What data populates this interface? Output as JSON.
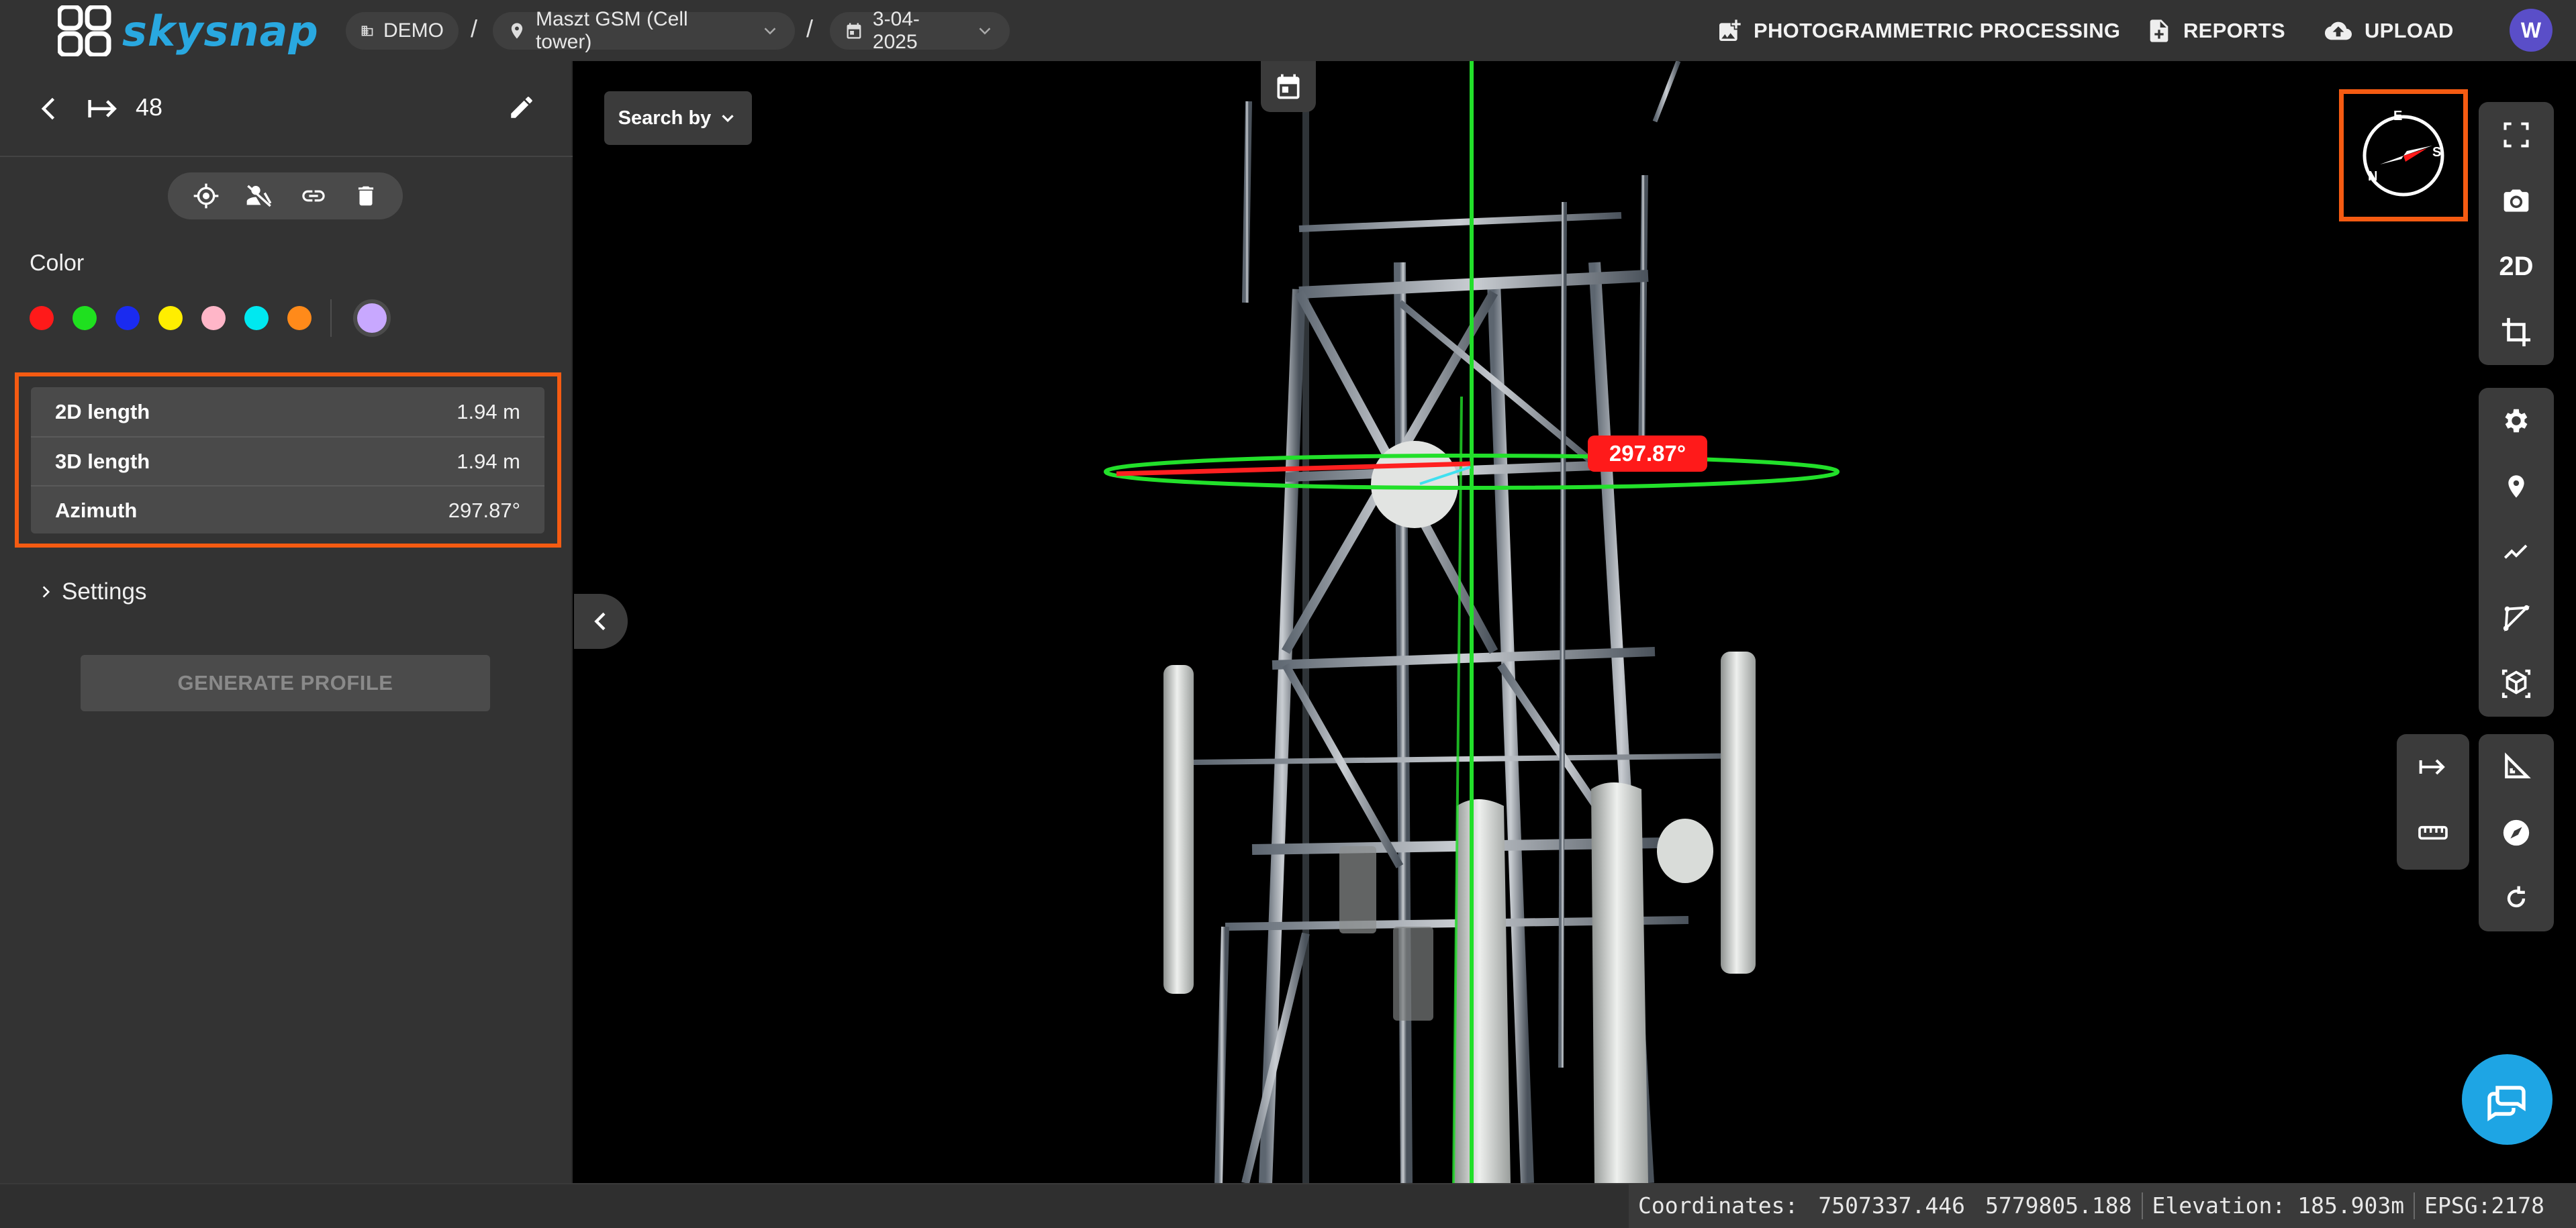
{
  "brand": {
    "name": "skysnap",
    "color": "#29a8e0"
  },
  "breadcrumb": {
    "org": "DEMO",
    "site": "Maszt GSM (Cell tower)",
    "date": "3-04-2025",
    "separator": "/"
  },
  "top_actions": {
    "processing": "PHOTOGRAMMETRIC PROCESSING",
    "reports": "REPORTS",
    "upload": "UPLOAD",
    "avatar_initial": "W"
  },
  "sidebar": {
    "measurement_id": "48",
    "tools": [
      "locate-icon",
      "hide-icon",
      "link-icon",
      "delete-icon"
    ],
    "color_label": "Color",
    "colors": [
      "#ff1a1a",
      "#1fe01f",
      "#1a2bf0",
      "#ffee00",
      "#ffb6c8",
      "#00e8f0",
      "#ff8a1a"
    ],
    "selected_color": "#c8a8ff",
    "properties": [
      {
        "label": "2D length",
        "value": "1.94 m"
      },
      {
        "label": "3D length",
        "value": "1.94 m"
      },
      {
        "label": "Azimuth",
        "value": "297.87°"
      }
    ],
    "settings_label": "Settings",
    "generate_label": "GENERATE PROFILE"
  },
  "viewer": {
    "search_label": "Search by",
    "azimuth_tag": "297.87°",
    "compass_letters": {
      "n": "N",
      "e": "E",
      "s": "S"
    },
    "right_tools": [
      "fullscreen-icon",
      "camera-icon",
      "crop-icon",
      "settings-icon",
      "pin-icon",
      "polyline-icon",
      "polygon-icon",
      "cube-icon",
      "angle-icon",
      "compass-nav-icon",
      "rotate-icon"
    ],
    "mode_2d_label": "2D",
    "left_tools": [
      "distance-icon",
      "ruler-icon"
    ]
  },
  "status": {
    "coordinates_label": "Coordinates:",
    "x": "7507337.446",
    "y": "5779805.188",
    "elevation_label": "Elevation:",
    "elevation": "185.903m",
    "epsg": "EPSG:2178"
  },
  "accent_color": "#f55b12"
}
